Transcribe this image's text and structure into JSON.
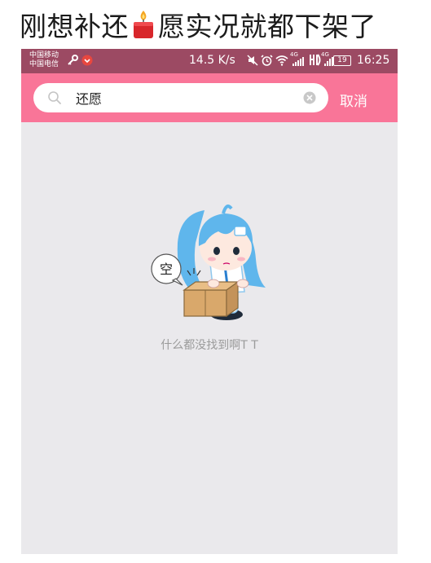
{
  "caption": {
    "text_before": "刚想补还",
    "text_after": "愿实况就都下架了",
    "icon": "candle-emoji-icon"
  },
  "status_bar": {
    "carrier_1": "中国移动",
    "carrier_2": "中国电信",
    "network_speed": "14.5 K/s",
    "signal_label_1": "4G",
    "signal_label_2": "4G",
    "battery_level": "19",
    "time": "16:25",
    "background_color": "#9c4a63"
  },
  "search": {
    "query": "还愿",
    "cancel_label": "取消",
    "header_color": "#f97598"
  },
  "empty_state": {
    "bubble_text": "空",
    "message": "什么都没找到啊T T"
  },
  "colors": {
    "app_background": "#eae9ec",
    "hair": "#5fb6ec",
    "box": "#d9a86b"
  }
}
